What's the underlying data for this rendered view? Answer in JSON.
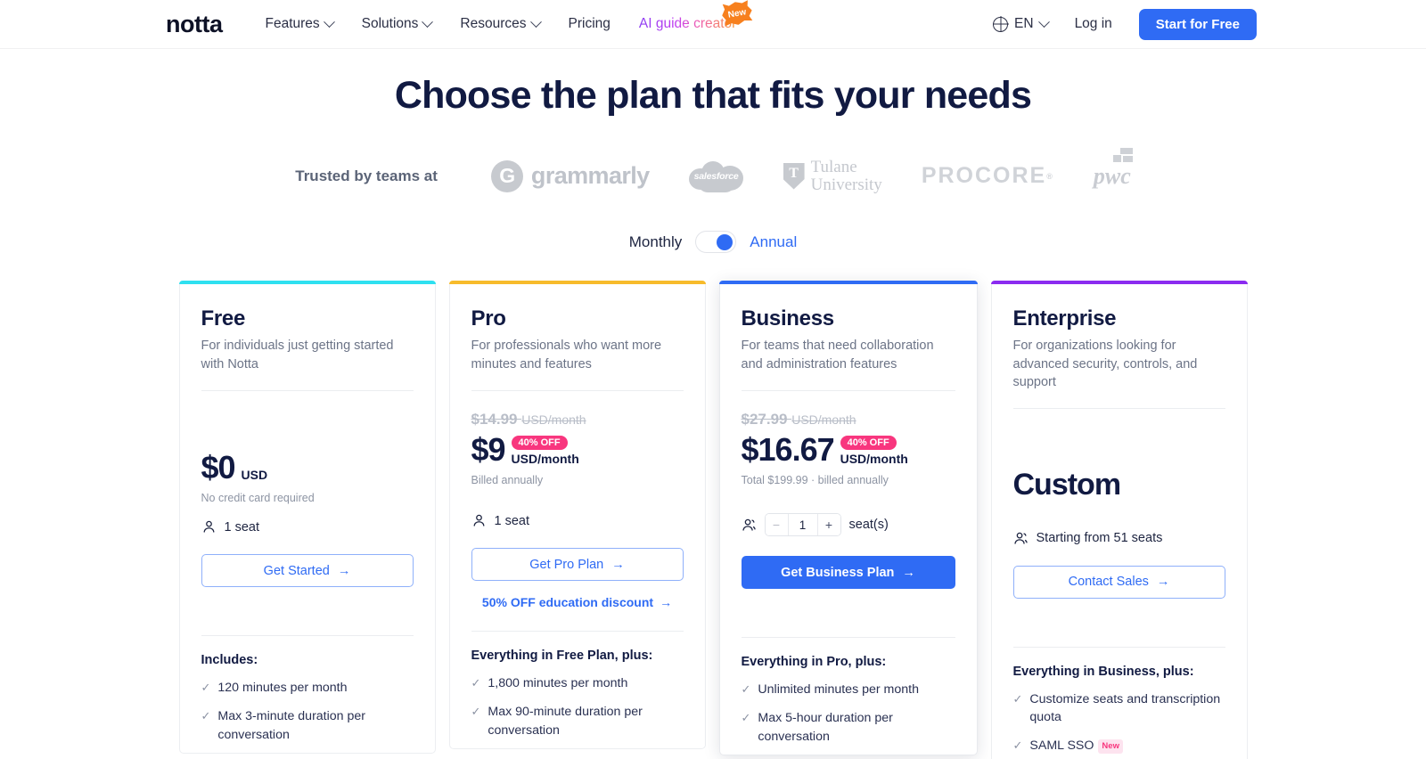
{
  "nav": {
    "logo": "notta",
    "links": [
      {
        "label": "Features",
        "caret": true
      },
      {
        "label": "Solutions",
        "caret": true
      },
      {
        "label": "Resources",
        "caret": true
      },
      {
        "label": "Pricing",
        "caret": false
      }
    ],
    "ai_link": "AI guide creator",
    "ai_badge": "New",
    "language": "EN",
    "login": "Log in",
    "cta": "Start for Free"
  },
  "hero": {
    "title": "Choose the plan that fits your needs",
    "trusted_label": "Trusted by teams at",
    "logos": [
      "grammarly",
      "salesforce",
      "Tulane University",
      "PROCORE",
      "pwc"
    ]
  },
  "billing": {
    "monthly_label": "Monthly",
    "annual_label": "Annual",
    "selected": "Annual"
  },
  "colors": {
    "free_accent": "#2ee0f0",
    "pro_accent": "#f7bb2b",
    "business_accent": "#2f6bf4",
    "enterprise_accent": "#8b2bf0",
    "primary": "#2f6bf4",
    "discount_badge": "#f8367e",
    "heading": "#111a42"
  },
  "plans": [
    {
      "name": "Free",
      "description": "For individuals just getting started with Notta",
      "old_price": "",
      "old_price_unit": "",
      "amount": "$0",
      "discount": "",
      "unit": "USD",
      "subnote": "No credit card required",
      "seats_text": "1 seat",
      "cta": "Get Started",
      "cta_style": "outline",
      "edu_link": "",
      "features_title": "Includes:",
      "features": [
        {
          "text": "120 minutes per month",
          "badge": ""
        },
        {
          "text": "Max 3-minute duration per conversation",
          "badge": ""
        }
      ]
    },
    {
      "name": "Pro",
      "description": "For professionals who want more minutes and features",
      "old_price": "$14.99",
      "old_price_unit": "USD/month",
      "amount": "$9",
      "discount": "40% OFF",
      "unit": "USD/month",
      "subnote": "Billed annually",
      "seats_text": "1 seat",
      "cta": "Get Pro Plan",
      "cta_style": "outline",
      "edu_link": "50% OFF education discount",
      "features_title": "Everything in Free Plan, plus:",
      "features": [
        {
          "text": "1,800 minutes per month",
          "badge": ""
        },
        {
          "text": "Max 90-minute duration per conversation",
          "badge": ""
        }
      ]
    },
    {
      "name": "Business",
      "description": "For teams that need collaboration and administration features",
      "old_price": "$27.99",
      "old_price_unit": "USD/month",
      "amount": "$16.67",
      "discount": "40% OFF",
      "unit": "USD/month",
      "subnote": "Total $199.99 · billed annually",
      "seats_text": "seat(s)",
      "seat_count": "1",
      "cta": "Get Business Plan",
      "cta_style": "filled",
      "edu_link": "",
      "features_title": "Everything in Pro, plus:",
      "features": [
        {
          "text": "Unlimited minutes per month",
          "badge": ""
        },
        {
          "text": "Max 5-hour duration per conversation",
          "badge": ""
        }
      ]
    },
    {
      "name": "Enterprise",
      "description": "For organizations looking for advanced security, controls, and support",
      "old_price": "",
      "old_price_unit": "",
      "amount": "Custom",
      "discount": "",
      "unit": "",
      "subnote": "",
      "seats_text": "Starting from 51 seats",
      "cta": "Contact Sales",
      "cta_style": "outline",
      "edu_link": "",
      "features_title": "Everything in Business, plus:",
      "features": [
        {
          "text": "Customize seats and transcription quota",
          "badge": ""
        },
        {
          "text": "SAML SSO",
          "badge": "New"
        }
      ]
    }
  ]
}
